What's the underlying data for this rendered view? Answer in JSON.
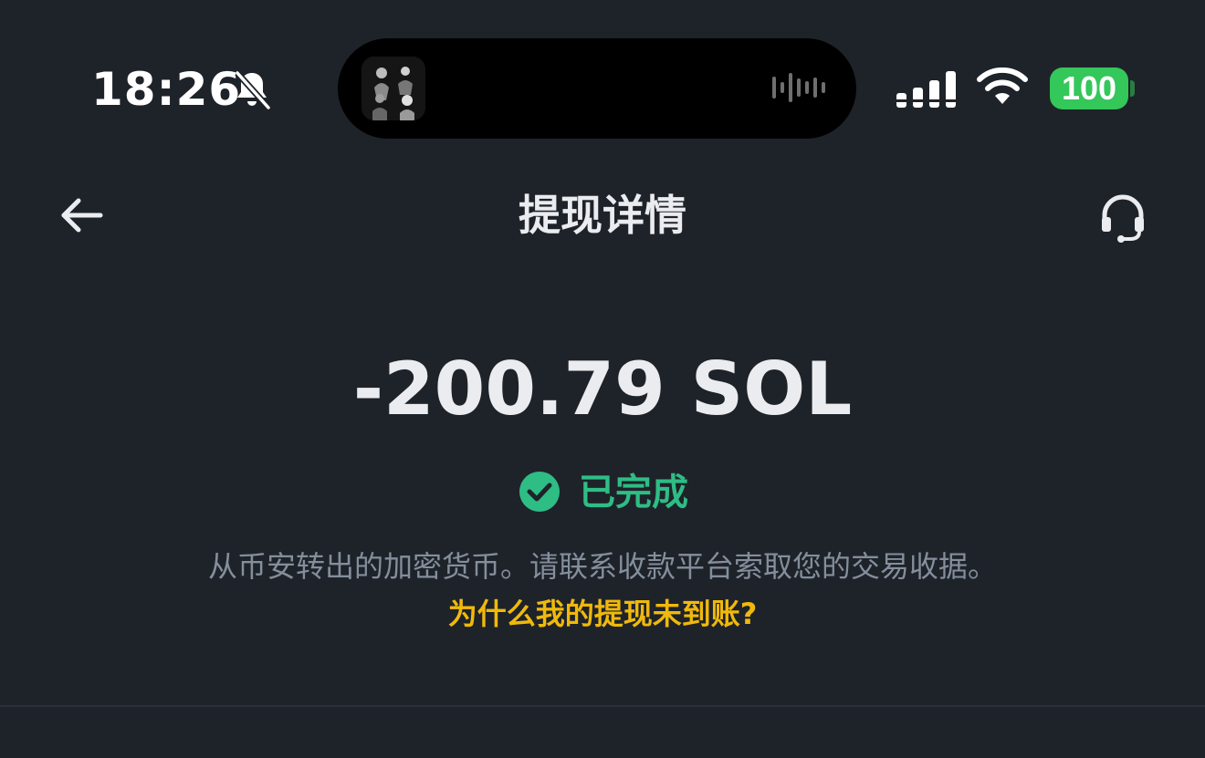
{
  "status_bar": {
    "time": "18:26",
    "battery": "100",
    "icons": [
      "bell-slash-icon",
      "audio-wave-icon",
      "signal-icon",
      "wifi-icon",
      "battery-icon"
    ],
    "colors": {
      "battery": "#34c759"
    }
  },
  "header": {
    "title": "提现详情",
    "back_icon": "arrow-left-icon",
    "support_icon": "headset-icon"
  },
  "transaction": {
    "amount": "-200.79 SOL",
    "status": "已完成",
    "status_icon": "check-circle-icon",
    "description": "从币安转出的加密货币。请联系收款平台索取您的交易收据。",
    "help_link": "为什么我的提现未到账?"
  },
  "colors": {
    "background": "#1e2329",
    "success": "#2ebd85",
    "link": "#f0b90b",
    "secondary_text": "#848e9c"
  }
}
